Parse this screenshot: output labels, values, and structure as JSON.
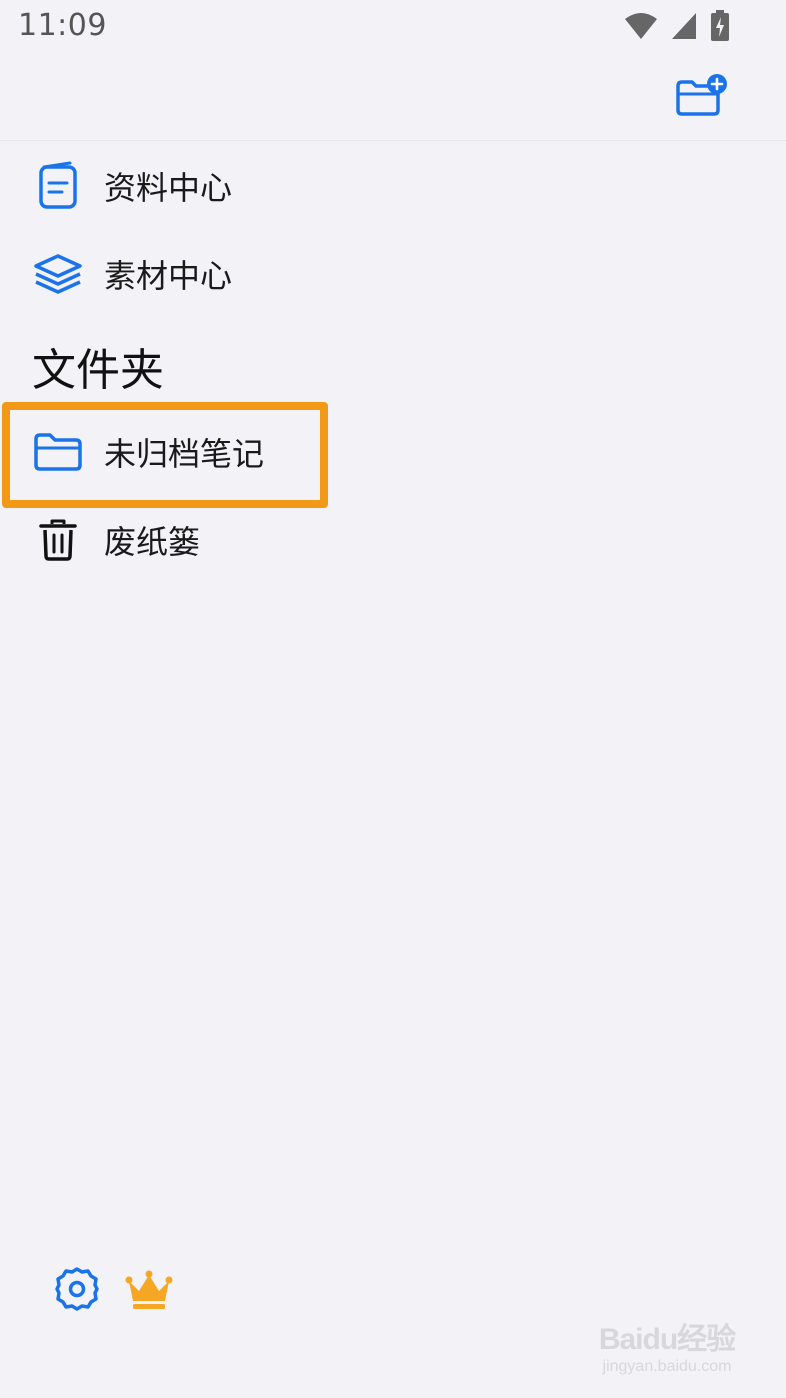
{
  "status_bar": {
    "time": "11:09"
  },
  "nav": {
    "items": [
      {
        "label": "资料中心",
        "icon": "document-icon"
      },
      {
        "label": "素材中心",
        "icon": "layers-icon"
      }
    ]
  },
  "folders": {
    "title": "文件夹",
    "items": [
      {
        "label": "未归档笔记",
        "icon": "folder-icon",
        "highlighted": true
      },
      {
        "label": "废纸篓",
        "icon": "trash-icon"
      }
    ]
  },
  "colors": {
    "accent": "#1a73e8",
    "highlight": "#f29a17",
    "crown": "#f5a623",
    "background": "#f2f2f7"
  },
  "watermark": {
    "main": "Baidu经验",
    "sub": "jingyan.baidu.com"
  }
}
